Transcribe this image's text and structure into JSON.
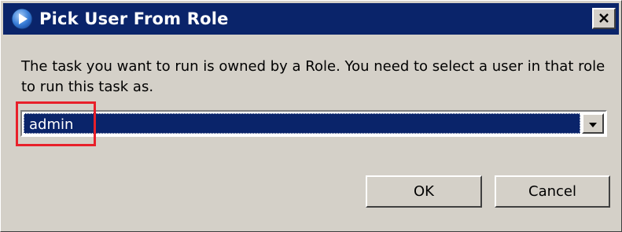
{
  "window": {
    "title": "Pick User From Role",
    "icon": "arrow-play-icon",
    "close_label": "x"
  },
  "message": "The task you want to run is owned by a Role. You need to select a user in that role to run this task as.",
  "user_select": {
    "selected": "admin",
    "arrow_icon": "dropdown-arrow-icon"
  },
  "buttons": {
    "ok": "OK",
    "cancel": "Cancel"
  },
  "colors": {
    "titlebar": "#0a246a",
    "dialog_bg": "#d4d0c8",
    "selection": "#0a246a",
    "highlight": "#e8202a"
  }
}
